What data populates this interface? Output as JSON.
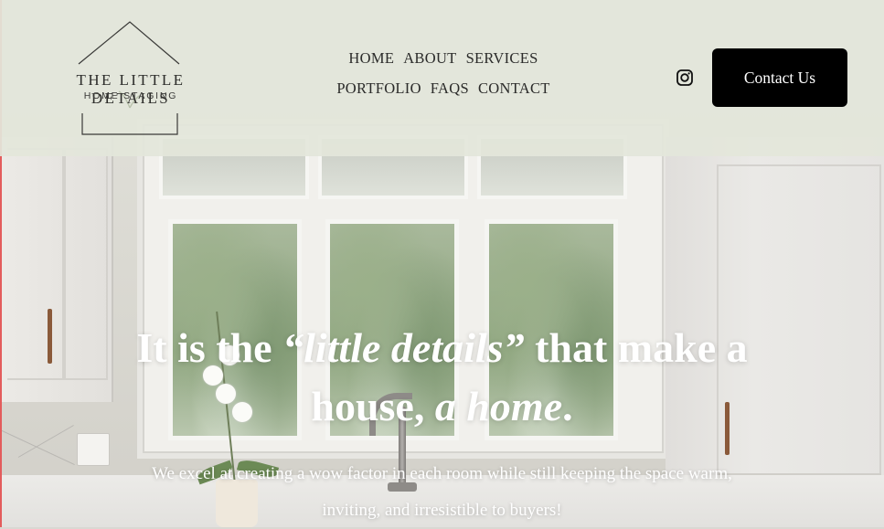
{
  "brand": {
    "title": "THE LITTLE DETAILS",
    "subtitle": "HOME STAGING"
  },
  "nav": {
    "row1": [
      "HOME",
      "ABOUT",
      "SERVICES"
    ],
    "row2": [
      "PORTFOLIO",
      "FAQS",
      "CONTACT"
    ]
  },
  "header_actions": {
    "instagram_icon": "instagram-icon",
    "contact_label": "Contact Us"
  },
  "hero": {
    "headline_part1": "It is the ",
    "headline_italic1": "“little details”",
    "headline_part2": " that make a house, ",
    "headline_italic2": "a home",
    "headline_end": ".",
    "subtext": "We excel at creating a wow factor in each room while still keeping the space warm, inviting, and irresistible to buyers!"
  },
  "colors": {
    "header_bg": "#e3e6da",
    "button_bg": "#000000",
    "button_text": "#ffffff",
    "hero_text": "#ffffff"
  }
}
